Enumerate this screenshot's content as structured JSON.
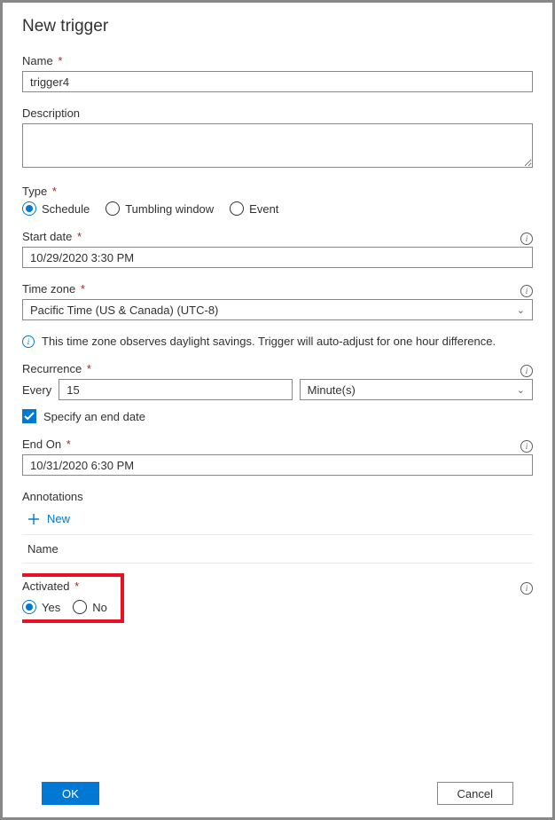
{
  "panel": {
    "title": "New trigger"
  },
  "name": {
    "label": "Name",
    "value": "trigger4"
  },
  "description": {
    "label": "Description",
    "value": ""
  },
  "type": {
    "label": "Type",
    "options": [
      "Schedule",
      "Tumbling window",
      "Event"
    ],
    "selected": "Schedule"
  },
  "startDate": {
    "label": "Start date",
    "value": "10/29/2020 3:30 PM"
  },
  "timeZone": {
    "label": "Time zone",
    "value": "Pacific Time (US & Canada) (UTC-8)",
    "note": "This time zone observes daylight savings. Trigger will auto-adjust for one hour difference."
  },
  "recurrence": {
    "label": "Recurrence",
    "everyLabel": "Every",
    "everyValue": "15",
    "unit": "Minute(s)"
  },
  "endDate": {
    "checkboxLabel": "Specify an end date",
    "checked": true,
    "label": "End On",
    "value": "10/31/2020 6:30 PM"
  },
  "annotations": {
    "label": "Annotations",
    "newLabel": "New",
    "columnHeader": "Name"
  },
  "activated": {
    "label": "Activated",
    "options": [
      "Yes",
      "No"
    ],
    "selected": "Yes"
  },
  "footer": {
    "ok": "OK",
    "cancel": "Cancel"
  }
}
